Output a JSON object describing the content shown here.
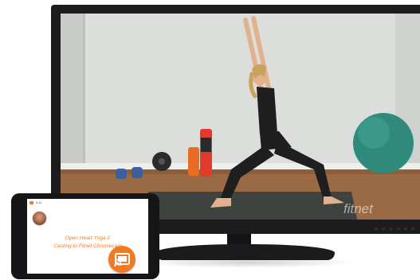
{
  "tv": {
    "watermark": "fitnet",
    "indicators": "▭ ▭ ▭ ▭ ▭ ▭"
  },
  "tablet": {
    "status_text": "9:41",
    "workout_title": "Open Heart Yoga 2",
    "cast_status": "Casting to Fitnet Chromecast"
  },
  "icons": {
    "cast": "cast-icon",
    "avatar": "avatar"
  },
  "colors": {
    "accent": "#f47a20",
    "tv_frame": "#1c1c1e",
    "wall": "#d9dbd8",
    "floor": "#9a6a44"
  }
}
